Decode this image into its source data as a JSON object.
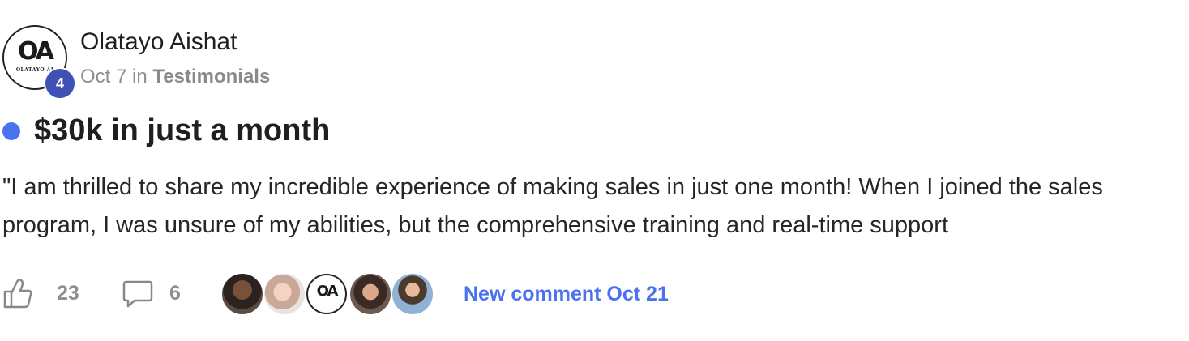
{
  "author": {
    "name": "Olatayo Aishat",
    "avatar_initials": "OA",
    "avatar_subtext": "OLATAYO AI",
    "level": "4"
  },
  "post": {
    "date": "Oct 7",
    "in_word": "in",
    "category": "Testimonials",
    "title": "$30k in just a month",
    "body": "\"I am thrilled to share my incredible experience of making sales in just one month! When I joined the sales program, I was unsure of my abilities, but the comprehensive training and real-time support",
    "unread_color": "#4a72f0"
  },
  "footer": {
    "likes": "23",
    "comments": "6",
    "like_icon": "thumbs-up-icon",
    "comment_icon": "comment-bubble-icon",
    "commenter_count": 5,
    "commenter_oa_initials": "OA",
    "new_comment_label": "New comment Oct 21",
    "accent_color": "#4a72f0"
  }
}
